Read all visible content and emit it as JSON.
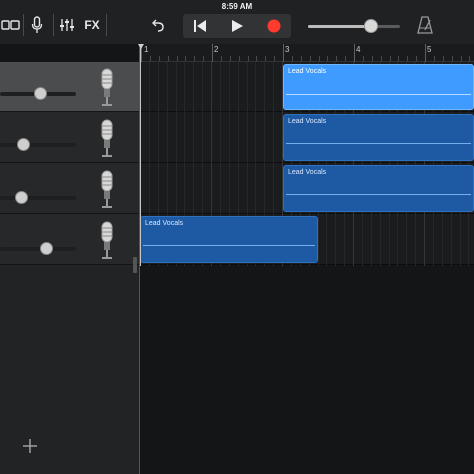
{
  "status_bar": {
    "time": "8:59 AM"
  },
  "toolbar": {
    "fx_label": "FX",
    "master_volume": 0.68
  },
  "ruler": {
    "bars": [
      "1",
      "2",
      "3",
      "4",
      "5"
    ]
  },
  "tracks": [
    {
      "volume": 0.52,
      "selected": true
    },
    {
      "volume": 0.3,
      "selected": false
    },
    {
      "volume": 0.28,
      "selected": false
    },
    {
      "volume": 0.6,
      "selected": false
    }
  ],
  "regions": [
    {
      "title": "Lead Vocals",
      "track": 1,
      "selected": true
    },
    {
      "title": "Lead Vocals",
      "track": 2,
      "selected": false
    },
    {
      "title": "Lead Vocals",
      "track": 3,
      "selected": false
    },
    {
      "title": "Lead Vocals",
      "track": 4,
      "selected": false
    }
  ],
  "colors": {
    "region_selected": "#3f9bff",
    "region_normal": "#1d5aa3",
    "record": "#ff3b30",
    "toolbar": "#202122"
  },
  "icons": [
    "track-view-icon",
    "mic-icon",
    "mixer-icon",
    "undo-icon",
    "rewind-icon",
    "play-icon",
    "record-icon",
    "metronome-icon",
    "add-icon",
    "microphone-instrument-icon"
  ]
}
